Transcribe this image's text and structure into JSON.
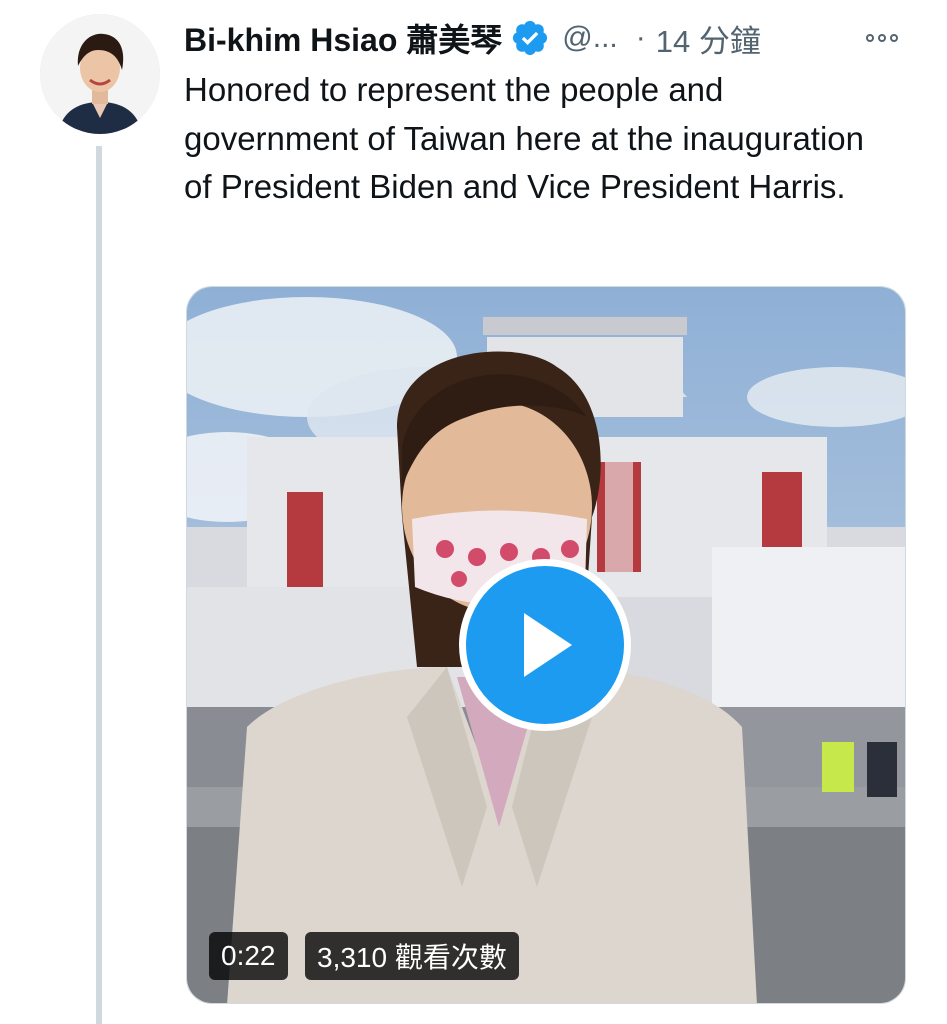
{
  "tweet": {
    "author": {
      "display_name": "Bi-khim Hsiao 蕭美琴",
      "handle": "@...",
      "verified": true,
      "avatar_icon": "profile-photo"
    },
    "timestamp": "14 分鐘",
    "separator": "·",
    "more_icon": "more-options-icon",
    "text": "Honored to represent the people and government of Taiwan here at the inauguration of President Biden and Vice President Harris.",
    "media": {
      "type": "video",
      "duration": "0:22",
      "views": "3,310 觀看次數"
    }
  },
  "colors": {
    "accent": "#1d9bf0",
    "text_primary": "#0f1419",
    "text_secondary": "#536471",
    "thread_line": "#cfd9de"
  }
}
